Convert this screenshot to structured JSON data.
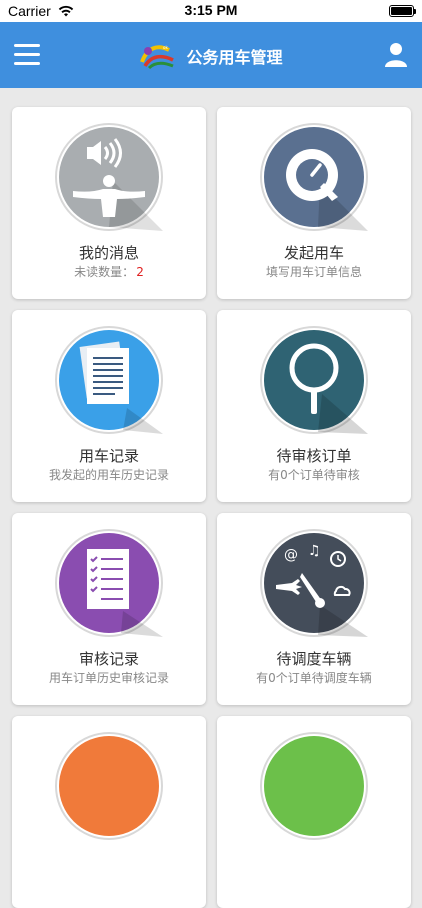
{
  "status_bar": {
    "carrier": "Carrier",
    "time": "3:15 PM"
  },
  "header": {
    "title": "公务用车管理",
    "background": "#3f8fde"
  },
  "tiles": [
    {
      "label": "我的消息",
      "sub_prefix": "未读数量：",
      "sub_count": "2",
      "icon": "megaphone-person-icon",
      "color": "#a9adb0"
    },
    {
      "label": "发起用车",
      "sub": "填写用车订单信息",
      "icon": "quicktime-icon",
      "color": "#5a7090"
    },
    {
      "label": "用车记录",
      "sub": "我发起的用车历史记录",
      "icon": "document-stack-icon",
      "color": "#3aa0e8"
    },
    {
      "label": "待审核订单",
      "sub": "有0个订单待审核",
      "icon": "magnifier-icon",
      "color": "#2f6373"
    },
    {
      "label": "审核记录",
      "sub": "用车订单历史审核记录",
      "icon": "checklist-icon",
      "color": "#8a4db0"
    },
    {
      "label": "待调度车辆",
      "sub": "有0个订单待调度车辆",
      "icon": "dashboard-gauge-icon",
      "color": "#444d5a"
    }
  ]
}
